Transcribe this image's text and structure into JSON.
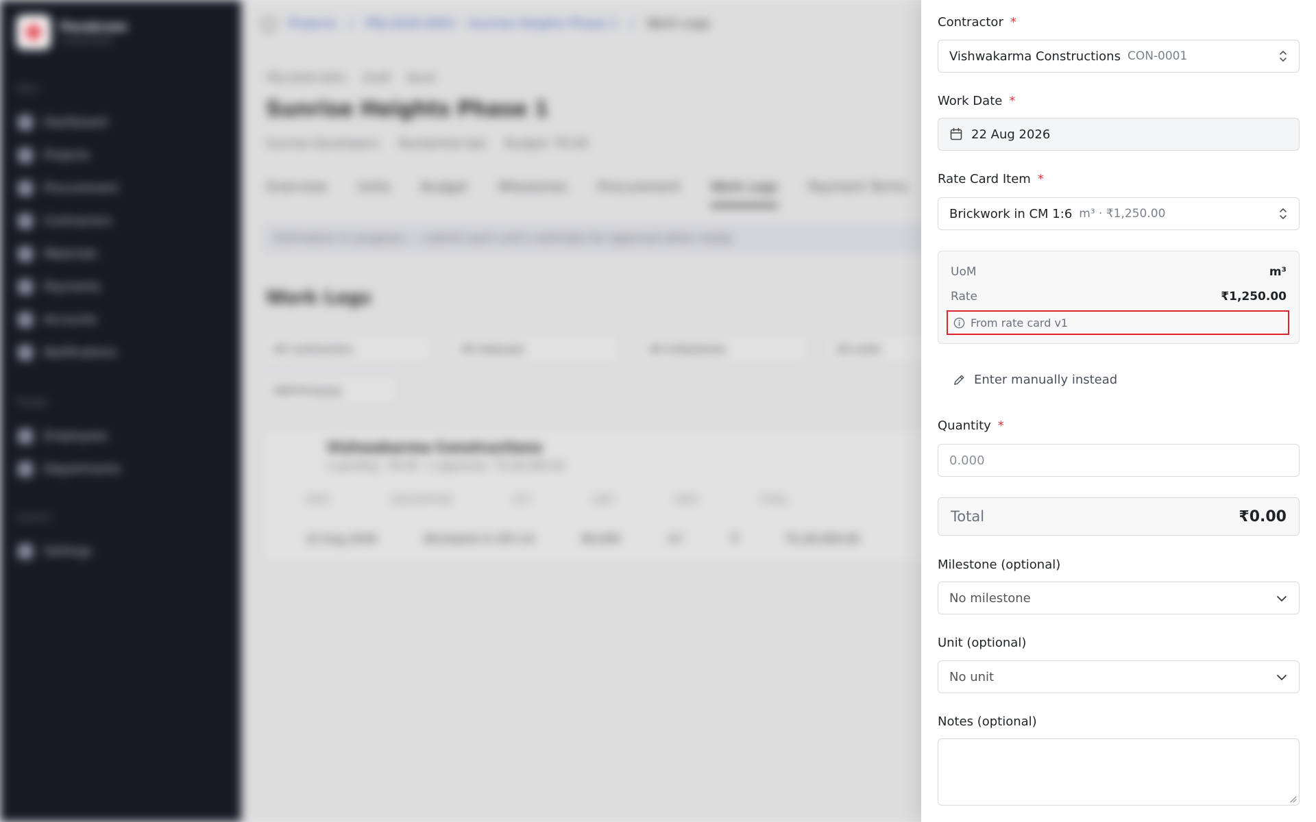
{
  "background": {
    "brand": {
      "name": "Parakram",
      "subtitle": "Construction"
    },
    "sidebar": {
      "sections": [
        "Main",
        "People",
        "System"
      ],
      "items": [
        "Dashboard",
        "Projects",
        "Procurement",
        "Contractors",
        "Materials",
        "Payments",
        "Accounts",
        "Notifications",
        "Employees",
        "Departments",
        "Settings"
      ]
    },
    "breadcrumbs": [
      "Projects",
      "PRJ-2026-0001 · Sunrise Heights Phase 1",
      "Work Logs"
    ],
    "project": {
      "code": "PRJ-2026-0001",
      "status": "Draft",
      "status2": "Bond",
      "title": "Sunrise Heights Phase 1",
      "client": "Sunrise Developers",
      "type": "Residential Apt",
      "budget": "Budget: ₹0.00"
    },
    "tabs": [
      "Overview",
      "Units",
      "Budget",
      "Milestones",
      "Procurement",
      "Work Logs",
      "Payment Terms"
    ],
    "banner": "Estimation in progress — submit each unit's estimate for approval when ready.",
    "section_title": "Work Logs",
    "filters": [
      "All contractors",
      "All statuses",
      "All milestones",
      "All units"
    ],
    "date_filter": "dd/mm/yyyy",
    "card": {
      "title": "Vishwakarma Constructions",
      "subtitle": "1 pending · ₹0.00 · 1 approved · ₹1,00,000.00",
      "headers": [
        "DATE",
        "DESCRIPTION",
        "QTY",
        "UNIT",
        "RATE",
        "TOTAL"
      ],
      "row": [
        "22 Aug 2026",
        "Brickwork in CM 1:6",
        "80.000",
        "m³",
        "₹",
        "₹1,00,000.00"
      ]
    }
  },
  "form": {
    "contractor": {
      "label": "Contractor",
      "value": "Vishwakarma Constructions",
      "code": "CON-0001"
    },
    "work_date": {
      "label": "Work Date",
      "value": "22 Aug 2026"
    },
    "rate_card_item": {
      "label": "Rate Card Item",
      "value": "Brickwork in CM 1:6",
      "meta": "m³ · ₹1,250.00"
    },
    "rate_info": {
      "uom_label": "UoM",
      "uom_value": "m³",
      "rate_label": "Rate",
      "rate_value": "₹1,250.00",
      "source_note": "From rate card v1"
    },
    "manual_link": "Enter manually instead",
    "quantity": {
      "label": "Quantity",
      "placeholder": "0.000"
    },
    "total": {
      "label": "Total",
      "value": "₹0.00"
    },
    "milestone": {
      "label": "Milestone (optional)",
      "value": "No milestone"
    },
    "unit": {
      "label": "Unit (optional)",
      "value": "No unit"
    },
    "notes": {
      "label": "Notes (optional)"
    },
    "required_marker": "*"
  },
  "colors": {
    "required": "#d73a3a",
    "highlight": "#d9252b",
    "sidebar": "#161a25",
    "link": "#3a66d6"
  }
}
